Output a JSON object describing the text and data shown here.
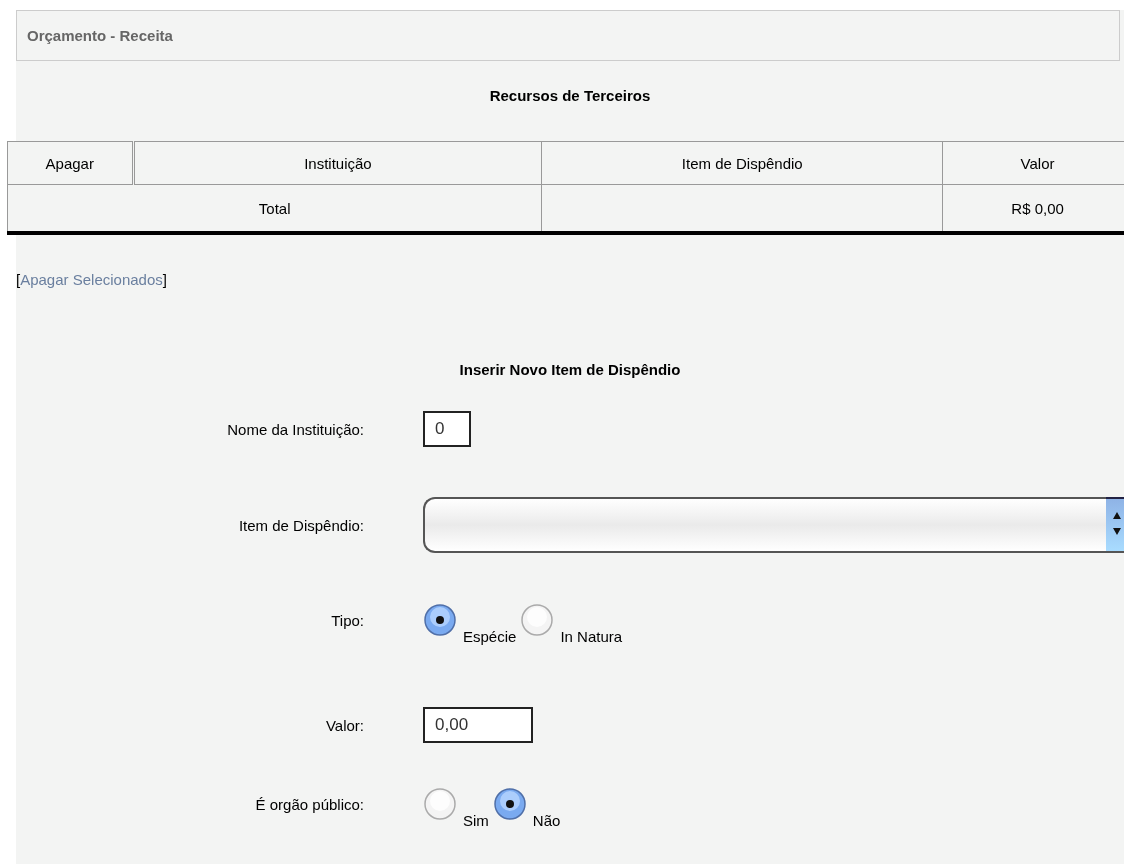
{
  "header": {
    "title": "Orçamento - Receita"
  },
  "section_title": "Recursos de Terceiros",
  "table": {
    "columns": [
      "Apagar",
      "Instituição",
      "Item de Dispêndio",
      "Valor"
    ],
    "total_row": {
      "label": "Total",
      "value": "R$ 0,00"
    }
  },
  "delete_link": {
    "open": "[",
    "label": "Apagar Selecionados",
    "close": "]"
  },
  "form": {
    "title": "Inserir Novo Item de Dispêndio",
    "fields": [
      {
        "kind": "text",
        "label": "Nome da Instituição:",
        "value": "0"
      },
      {
        "kind": "select",
        "label": "Item de Dispêndio:"
      },
      {
        "kind": "radio",
        "label": "Tipo:",
        "options": [
          {
            "label": "Espécie",
            "selected": true
          },
          {
            "label": "In Natura",
            "selected": false
          }
        ]
      },
      {
        "kind": "text",
        "label": "Valor:",
        "value": "0,00"
      },
      {
        "kind": "radio",
        "label": "É orgão público:",
        "options": [
          {
            "label": "Sim",
            "selected": false
          },
          {
            "label": "Não",
            "selected": true
          }
        ]
      }
    ]
  }
}
